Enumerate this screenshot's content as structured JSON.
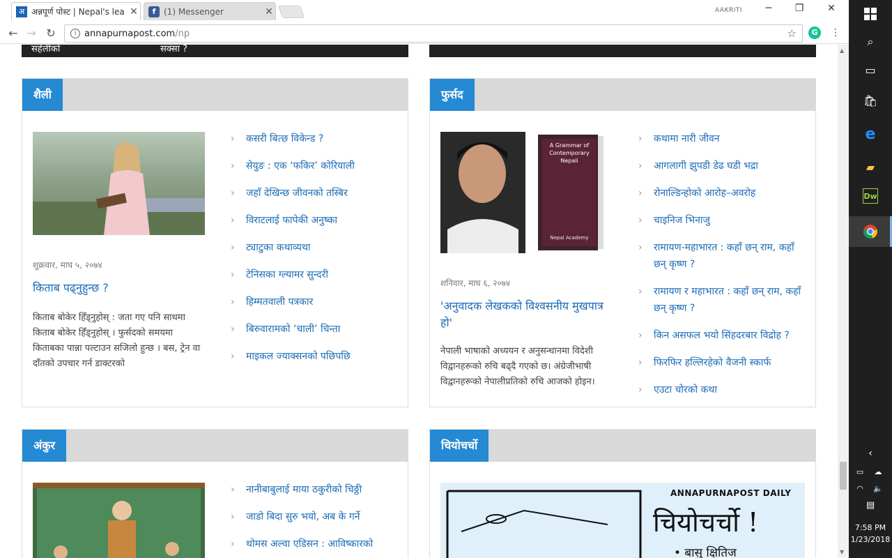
{
  "browser": {
    "tabs": [
      {
        "title": "अन्नपूर्ण पोस्ट | Nepal's lea",
        "favicon": "अ"
      },
      {
        "title": "(1) Messenger",
        "favicon": "f"
      }
    ],
    "profile": "AAKRITI",
    "url_host": "annapurnapost.com",
    "url_path": "/np"
  },
  "topbar": {
    "left_text": "सहेलीको",
    "left_text2": "सक्सा ?"
  },
  "panels": {
    "shaili": {
      "label": "शैली",
      "date": "शुक्रवार, माघ ५, २०७४",
      "feature_title": "किताब पढ्नुहुन्छ ?",
      "excerpt": "किताब बोकेर हिँड्नुहोस् : जता गए पनि साथमा किताब बोकेर हिँड्नुहोस् । फुर्सदको समयमा किताबका पान्ना पल्टाउन सजिलो हुन्छ । बस, ट्रेन वा दाँतको उपचार गर्न डाक्टरको",
      "links": [
        "कसरी बित्छ विकेन्ड ?",
        "सेयुङ : एक ‘फकिर’ कोरियाली",
        "जहाँ देखिन्छ जीवनको तस्बिर",
        "विराटलाई फापेकी अनुष्का",
        "ट्याटुका कथाव्यथा",
        "टेनिसका ग्ल्यामर सुन्दरी",
        "हिम्मतवाली पत्रकार",
        "बिरुवारामको ‘चाली’ चिन्ता",
        "माइकल ज्याक्सनको पछिपछि"
      ]
    },
    "fursad": {
      "label": "फुर्सद",
      "book_title": "A Grammar of Contemporary Nepali",
      "book_publisher": "Nepal Academy",
      "date": "शनिवार, माघ ६, २०७४",
      "feature_title": "'अनुवादक लेखकको विश्वसनीय मुखपात्र हो'",
      "excerpt": "नेपाली भाषाको अध्ययन र अनुसन्धानमा विदेशी विद्वानहरूको रुचि बढ्दै गएको छ। अंग्रेजीभाषी विद्वानहरूको नेपालीप्रतिको रुचि आजको होइन।",
      "links": [
        "कथामा नारी जीवन",
        "आगलागी झुपडी डेढ घडी भद्रा",
        "रोनाल्डिन्होको आरोह–अवरोह",
        "चाइनिज भिनाजु",
        "रामायण-महाभारत : कहाँ छन् राम, कहाँ छन् कृष्ण ?",
        "रामायण र महाभारत : कहाँ छन् राम, कहाँ छन् कृष्ण ?",
        "किन असफल भयो सिंहदरबार विद्रोह ?",
        "फिरफिर हल्लिरहेको वैजनी स्कार्फ",
        "एउटा चोरको कथा"
      ]
    },
    "ankur": {
      "label": "अंकुर",
      "links": [
        "नानीबाबुलाई माया ठकुरीको चिठ्ठी",
        "जाडो बिदा सुरु भयो, अब के गर्ने",
        "थोमस अल्वा एडिसन : आविष्कारको"
      ]
    },
    "chiyochurcho": {
      "label": "चियोचर्चो",
      "cartoon_brand": "ANNAPURNAPOST DAILY",
      "cartoon_title": "चियोचर्चो !",
      "cartoon_author": "• बासु क्षितिज"
    }
  },
  "taskbar": {
    "time": "7:58 PM",
    "date": "1/23/2018"
  }
}
